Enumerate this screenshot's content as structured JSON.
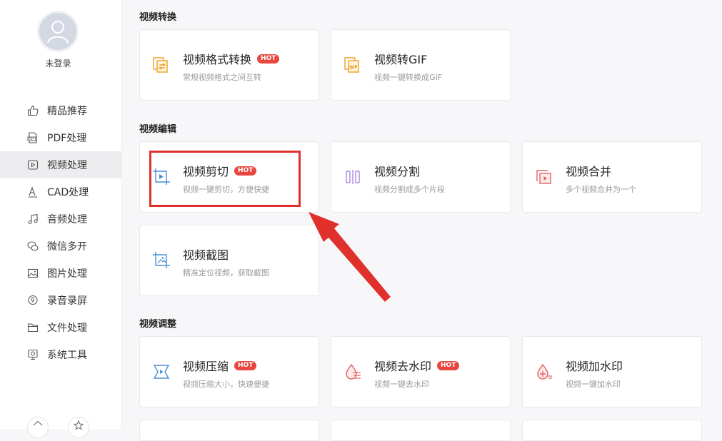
{
  "user": {
    "name": "未登录"
  },
  "sidebar": {
    "items": [
      {
        "label": "精品推荐",
        "icon": "thumbs-up-icon"
      },
      {
        "label": "PDF处理",
        "icon": "pdf-icon"
      },
      {
        "label": "视频处理",
        "icon": "video-icon",
        "active": true
      },
      {
        "label": "CAD处理",
        "icon": "cad-icon"
      },
      {
        "label": "音频处理",
        "icon": "music-icon"
      },
      {
        "label": "微信多开",
        "icon": "wechat-icon"
      },
      {
        "label": "图片处理",
        "icon": "image-icon"
      },
      {
        "label": "录音录屏",
        "icon": "record-icon"
      },
      {
        "label": "文件处理",
        "icon": "folder-icon"
      },
      {
        "label": "系统工具",
        "icon": "system-tools-icon"
      }
    ]
  },
  "sections": [
    {
      "title": "视频转换",
      "cards": [
        {
          "title": "视频格式转换",
          "desc": "常规视频格式之间互转",
          "hot": "HOT",
          "icon": "format-convert-icon"
        },
        {
          "title": "视频转GIF",
          "desc": "视频一键转换成GIF",
          "icon": "gif-icon"
        }
      ]
    },
    {
      "title": "视频编辑",
      "cards": [
        {
          "title": "视频剪切",
          "desc": "视频一键剪切，方便快捷",
          "hot": "HOT",
          "icon": "video-cut-icon"
        },
        {
          "title": "视频分割",
          "desc": "视频分割成多个片段",
          "icon": "video-split-icon"
        },
        {
          "title": "视频合并",
          "desc": "多个视频合并为一个",
          "icon": "video-merge-icon"
        },
        {
          "title": "视频截图",
          "desc": "精准定位视频，获取截图",
          "icon": "video-screenshot-icon"
        }
      ]
    },
    {
      "title": "视频调整",
      "cards": [
        {
          "title": "视频压缩",
          "desc": "视频压缩大小，快速便捷",
          "hot": "HOT",
          "icon": "video-compress-icon"
        },
        {
          "title": "视频去水印",
          "desc": "视频一键去水印",
          "hot": "HOT",
          "icon": "remove-watermark-icon"
        },
        {
          "title": "视频加水印",
          "desc": "视频一键加水印",
          "icon": "add-watermark-icon"
        }
      ]
    }
  ],
  "colors": {
    "hot_badge": "#e8463f",
    "highlight": "#e0302c",
    "orange_icon": "#f0a020",
    "blue_icon": "#4a8fd6",
    "red_icon": "#e06464",
    "purple_icon": "#a98be0"
  }
}
